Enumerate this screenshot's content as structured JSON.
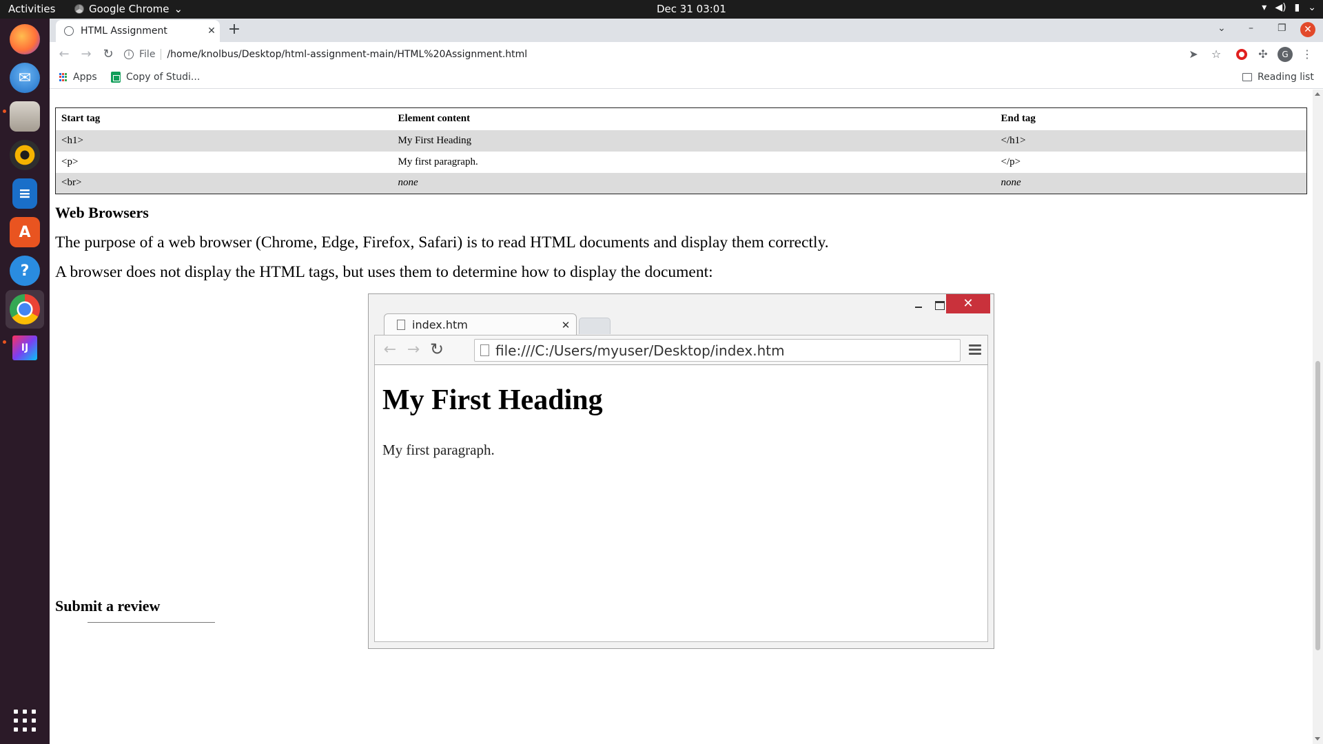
{
  "topbar": {
    "activities": "Activities",
    "app_name": "Google Chrome",
    "clock": "Dec 31  03:01"
  },
  "dock": {
    "items": [
      "firefox-icon",
      "thunderbird-icon",
      "files-icon",
      "rhythmbox-icon",
      "writer-icon",
      "software-icon",
      "help-icon",
      "chrome-icon",
      "intellij-icon",
      "show-apps-icon"
    ]
  },
  "browser": {
    "tab_title": "HTML Assignment",
    "address_scheme": "File",
    "address_url": "/home/knolbus/Desktop/html-assignment-main/HTML%20Assignment.html",
    "bookmarks": {
      "apps": "Apps",
      "item1": "Copy of Studi...",
      "reading_list": "Reading list"
    },
    "avatar_letter": "G"
  },
  "page": {
    "table": {
      "headers": [
        "Start tag",
        "Element content",
        "End tag"
      ],
      "rows": [
        [
          "<h1>",
          "My First Heading",
          "</h1>"
        ],
        [
          "<p>",
          "My first paragraph.",
          "</p>"
        ],
        [
          "<br>",
          "none",
          "none"
        ]
      ]
    },
    "web_browsers_heading": "Web Browsers",
    "para1": "The purpose of a web browser (Chrome, Edge, Firefox, Safari) is to read HTML documents and display them correctly.",
    "para2": "A browser does not display the HTML tags, but uses them to determine how to display the document:",
    "figure": {
      "tab_title": "index.htm",
      "url": "file:///C:/Users/myuser/Desktop/index.htm",
      "heading": "My First Heading",
      "paragraph": "My first paragraph."
    },
    "submit_heading": "Submit a review"
  },
  "colors": {
    "dock_bg": "#2b1a28",
    "topbar_bg": "#1c1c1c",
    "table_shade": "#dcdcdc",
    "figure_close": "#c9313b"
  }
}
